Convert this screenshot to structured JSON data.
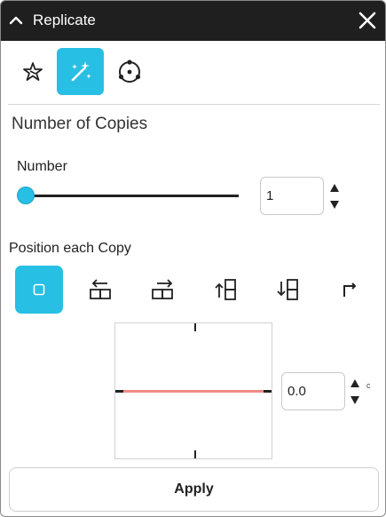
{
  "window": {
    "title": "Replicate"
  },
  "toolbar": {
    "items": [
      {
        "icon": "star-burst-icon",
        "active": false
      },
      {
        "icon": "magic-wand-icon",
        "active": true
      },
      {
        "icon": "radial-points-icon",
        "active": false
      }
    ]
  },
  "copies": {
    "section_title": "Number of Copies",
    "number_label": "Number",
    "slider_fraction": 0,
    "value": "1"
  },
  "position": {
    "label": "Position each Copy",
    "options": [
      {
        "icon": "square-icon",
        "active": true
      },
      {
        "icon": "arrow-left-box-icon",
        "active": false
      },
      {
        "icon": "arrow-right-box-icon",
        "active": false
      },
      {
        "icon": "arrow-up-box-icon",
        "active": false
      },
      {
        "icon": "arrow-down-box-icon",
        "active": false
      },
      {
        "icon": "corner-arrow-icon",
        "active": false
      }
    ],
    "offset_value": "0.0",
    "offset_unit": "c"
  },
  "apply_label": "Apply",
  "colors": {
    "accent": "#27bfe3",
    "titlebar": "#1f1f1f",
    "preview_line": "#f08a86"
  }
}
